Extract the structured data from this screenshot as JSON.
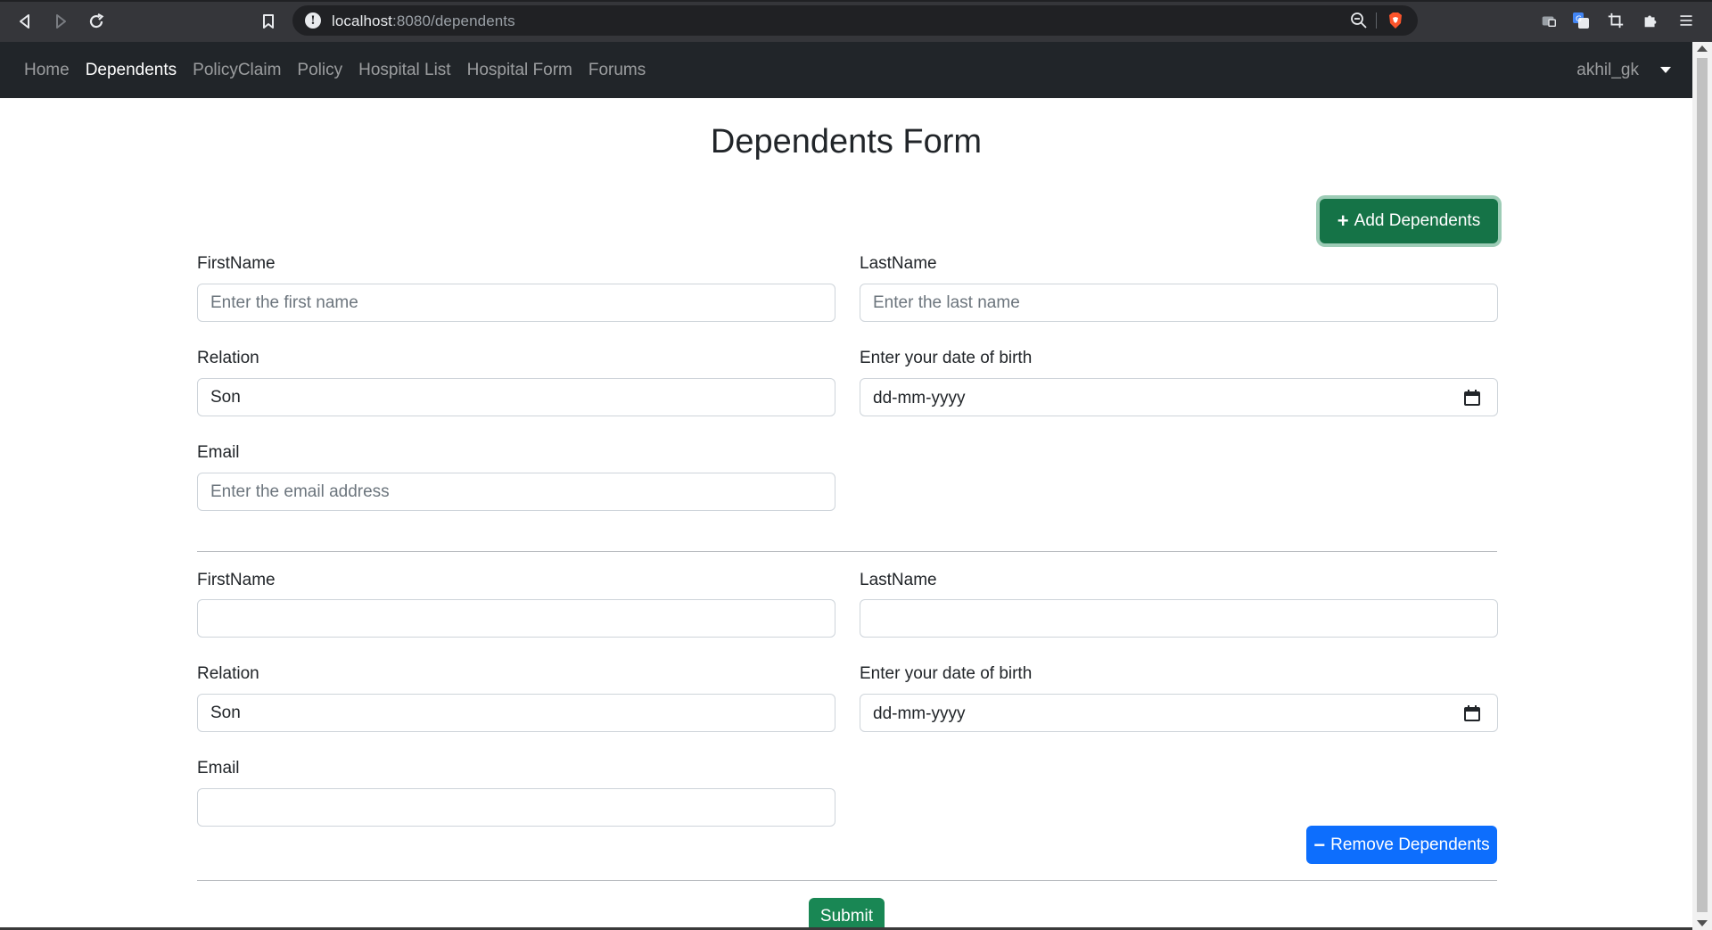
{
  "browser": {
    "url_host": "localhost",
    "url_rest": ":8080/dependents"
  },
  "navbar": {
    "links": [
      {
        "label": "Home"
      },
      {
        "label": "Dependents",
        "active": true
      },
      {
        "label": "PolicyClaim"
      },
      {
        "label": "Policy"
      },
      {
        "label": "Hospital List"
      },
      {
        "label": "Hospital Form"
      },
      {
        "label": "Forums"
      }
    ],
    "user": "akhil_gk"
  },
  "page": {
    "title": "Dependents Form",
    "add_button": "Add Dependents",
    "remove_button": "Remove Dependents",
    "submit_button": "Submit"
  },
  "dependents": [
    {
      "first_name_label": "FirstName",
      "first_name_placeholder": "Enter the first name",
      "last_name_label": "LastName",
      "last_name_placeholder": "Enter the last name",
      "relation_label": "Relation",
      "relation_value": "Son",
      "dob_label": "Enter your date of birth",
      "dob_value": "dd-mm-yyyy",
      "email_label": "Email",
      "email_placeholder": "Enter the email address"
    },
    {
      "first_name_label": "FirstName",
      "first_name_placeholder": "",
      "last_name_label": "LastName",
      "last_name_placeholder": "",
      "relation_label": "Relation",
      "relation_value": "Son",
      "dob_label": "Enter your date of birth",
      "dob_value": "dd-mm-yyyy",
      "email_label": "Email",
      "email_placeholder": ""
    }
  ],
  "colors": {
    "navbar_bg": "#212529",
    "add_button": "#157347",
    "remove_button": "#0d6efd",
    "submit_button": "#198754"
  }
}
